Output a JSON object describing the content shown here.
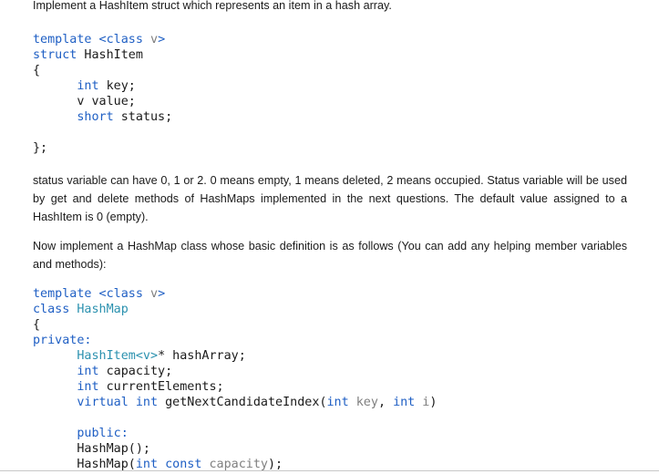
{
  "intro": "Implement a HashItem struct which represents an item in a hash array.",
  "hashitem_code": {
    "l1_kw": "template",
    "l1_rest": " <class ",
    "l1_type": "v",
    "l1_end": ">",
    "l2_kw": "struct",
    "l2_name": " HashItem",
    "l3": "{",
    "l4_kw": "int",
    "l4_rest": " key;",
    "l5": "v value;",
    "l6_kw": "short",
    "l6_rest": " status;",
    "l7": "};"
  },
  "status_text": "status variable can have 0, 1 or 2. 0 means empty, 1 means deleted, 2 means occupied. Status variable will be used by get and delete methods of HashMaps implemented in the next questions. The default value assigned to a HashItem is 0 (empty).",
  "hashmap_text": "Now implement a HashMap class whose basic definition is as follows (You can add any helping member variables and methods):",
  "hashmap_code": {
    "l1_kw": "template",
    "l1_rest": " <class ",
    "l1_type": "v",
    "l1_end": ">",
    "l2_kw": "class",
    "l2_name": " HashMap",
    "l3": "{",
    "l4": "private:",
    "l5_type": "HashItem<v>",
    "l5_rest": "* hashArray;",
    "l6_kw": "int",
    "l6_rest": " capacity;",
    "l7_kw": "int",
    "l7_rest": " currentElements;",
    "l8_kw": "virtual",
    "l8_kw2": " int",
    "l8_fn": " getNextCandidateIndex(",
    "l8_kw3": "int",
    "l8_p1": " key",
    "l8_sep": ", ",
    "l8_kw4": "int",
    "l8_p2": " i",
    "l8_end": ")",
    "l9": "public:",
    "l10": "HashMap();",
    "l11_fn": "HashMap(",
    "l11_kw": "int",
    "l11_kw2": " const",
    "l11_p": " capacity",
    "l11_end": ");"
  }
}
